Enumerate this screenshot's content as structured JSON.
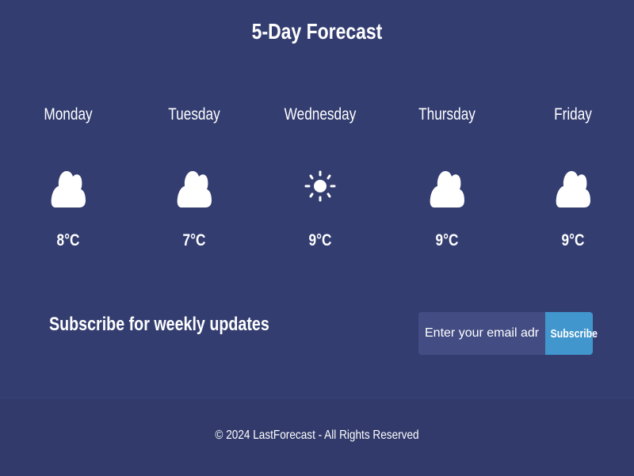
{
  "page": {
    "title": "5-Day Forecast"
  },
  "forecast": {
    "days": [
      {
        "name": "Monday",
        "temp": "8°C",
        "icon": "cloud-icon"
      },
      {
        "name": "Tuesday",
        "temp": "7°C",
        "icon": "cloud-icon"
      },
      {
        "name": "Wednesday",
        "temp": "9°C",
        "icon": "sun-icon"
      },
      {
        "name": "Thursday",
        "temp": "9°C",
        "icon": "cloud-icon"
      },
      {
        "name": "Friday",
        "temp": "9°C",
        "icon": "cloud-icon"
      }
    ]
  },
  "subscribe": {
    "label": "Subscribe for weekly updates",
    "email_placeholder": "Enter your email adress...",
    "email_value": "",
    "button_label": "Subscribe"
  },
  "footer": {
    "copyright": "© 2024 LastForecast - All Rights Reserved"
  },
  "colors": {
    "background": "#333d70",
    "input_background": "#434d83",
    "button_accent": "#4196cd",
    "text": "#ffffff"
  }
}
